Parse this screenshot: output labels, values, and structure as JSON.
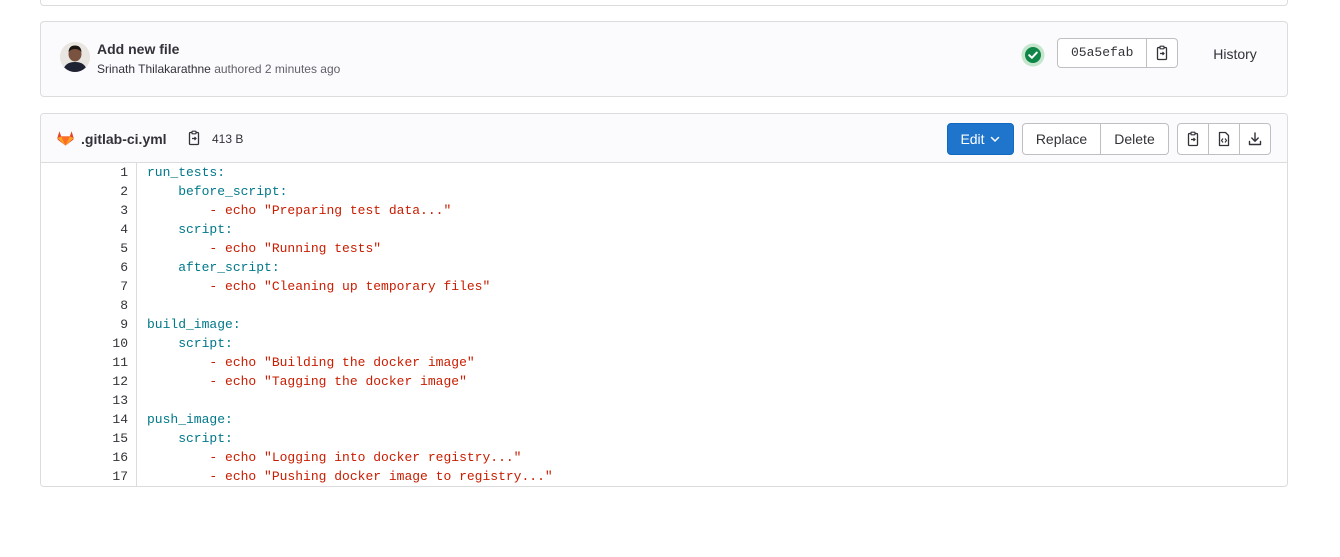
{
  "commit": {
    "title": "Add new file",
    "author": "Srinath Thilakarathne",
    "action": "authored",
    "time": "2 minutes ago",
    "sha": "05a5efab",
    "history_label": "History",
    "status_color": "#108548"
  },
  "file": {
    "name": ".gitlab-ci.yml",
    "size": "413 B",
    "edit_label": "Edit",
    "replace_label": "Replace",
    "delete_label": "Delete"
  },
  "code": {
    "lines": [
      {
        "n": "1",
        "key": "run_tests:",
        "dash": "",
        "cmd": "",
        "str": ""
      },
      {
        "n": "2",
        "key": "    before_script:",
        "dash": "",
        "cmd": "",
        "str": ""
      },
      {
        "n": "3",
        "key": "",
        "dash": "        - ",
        "cmd": "echo ",
        "str": "\"Preparing test data...\""
      },
      {
        "n": "4",
        "key": "    script:",
        "dash": "",
        "cmd": "",
        "str": ""
      },
      {
        "n": "5",
        "key": "",
        "dash": "        - ",
        "cmd": "echo ",
        "str": "\"Running tests\""
      },
      {
        "n": "6",
        "key": "    after_script:",
        "dash": "",
        "cmd": "",
        "str": ""
      },
      {
        "n": "7",
        "key": "",
        "dash": "        - ",
        "cmd": "echo ",
        "str": "\"Cleaning up temporary files\""
      },
      {
        "n": "8",
        "key": "",
        "dash": "",
        "cmd": "",
        "str": ""
      },
      {
        "n": "9",
        "key": "build_image:",
        "dash": "",
        "cmd": "",
        "str": ""
      },
      {
        "n": "10",
        "key": "    script:",
        "dash": "",
        "cmd": "",
        "str": ""
      },
      {
        "n": "11",
        "key": "",
        "dash": "        - ",
        "cmd": "echo ",
        "str": "\"Building the docker image\""
      },
      {
        "n": "12",
        "key": "",
        "dash": "        - ",
        "cmd": "echo ",
        "str": "\"Tagging the docker image\""
      },
      {
        "n": "13",
        "key": "",
        "dash": "",
        "cmd": "",
        "str": ""
      },
      {
        "n": "14",
        "key": "push_image:",
        "dash": "",
        "cmd": "",
        "str": ""
      },
      {
        "n": "15",
        "key": "    script:",
        "dash": "",
        "cmd": "",
        "str": ""
      },
      {
        "n": "16",
        "key": "",
        "dash": "        - ",
        "cmd": "echo ",
        "str": "\"Logging into docker registry...\""
      },
      {
        "n": "17",
        "key": "",
        "dash": "        - ",
        "cmd": "echo ",
        "str": "\"Pushing docker image to registry...\""
      }
    ]
  }
}
